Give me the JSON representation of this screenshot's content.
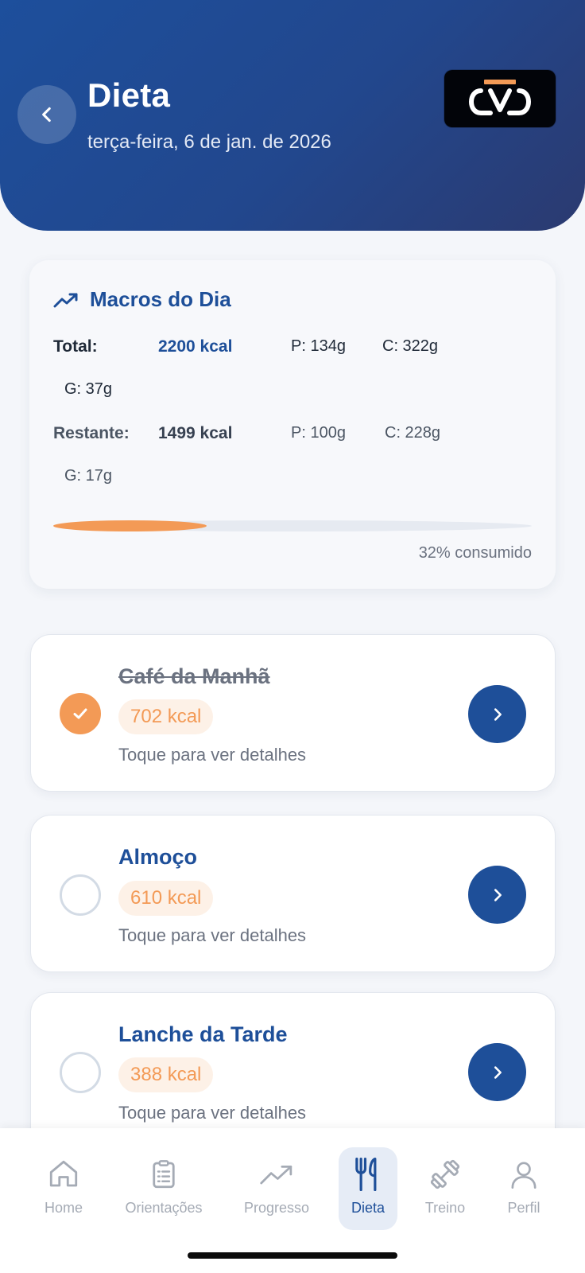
{
  "header": {
    "title": "Dieta",
    "date": "terça-feira, 6 de jan. de 2026",
    "colors": {
      "gradient_start": "#1d4f9c",
      "gradient_end": "#2b3a70"
    },
    "icons": {
      "back": "chevron-left-icon",
      "logo": "brand-logo"
    }
  },
  "macros": {
    "title": "Macros do Dia",
    "icon": "trending-up-icon",
    "total": {
      "label": "Total:",
      "kcal": "2200 kcal",
      "p": "P: 134g",
      "c": "C: 322g",
      "g": "G: 37g"
    },
    "remaining": {
      "label": "Restante:",
      "kcal": "1499 kcal",
      "p": "P: 100g",
      "c": "C: 228g",
      "g": "G: 17g"
    },
    "progress_percent": 32,
    "progress_label": "32% consumido",
    "colors": {
      "accent": "#1e4f99",
      "progress": "#f39a56"
    }
  },
  "meals": [
    {
      "name": "Café da Manhã",
      "kcal": "702 kcal",
      "hint": "Toque para ver detalhes",
      "done": true
    },
    {
      "name": "Almoço",
      "kcal": "610 kcal",
      "hint": "Toque para ver detalhes",
      "done": false
    },
    {
      "name": "Lanche da Tarde",
      "kcal": "388 kcal",
      "hint": "Toque para ver detalhes",
      "done": false
    }
  ],
  "nav": {
    "items": [
      {
        "label": "Home",
        "icon": "home-icon"
      },
      {
        "label": "Orientações",
        "icon": "clipboard-icon"
      },
      {
        "label": "Progresso",
        "icon": "trending-up-icon"
      },
      {
        "label": "Dieta",
        "icon": "utensils-icon",
        "active": true
      },
      {
        "label": "Treino",
        "icon": "dumbbell-icon"
      },
      {
        "label": "Perfil",
        "icon": "user-icon"
      }
    ]
  }
}
